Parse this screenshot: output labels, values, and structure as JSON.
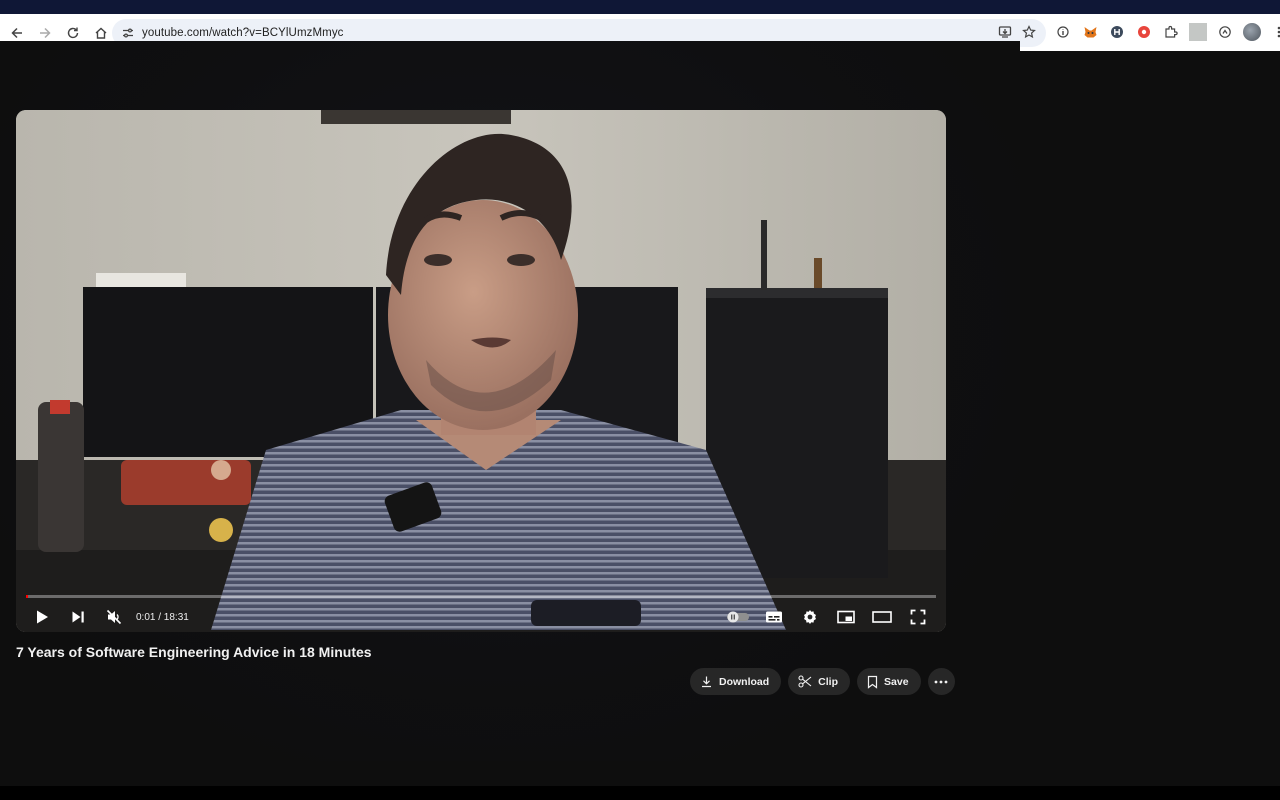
{
  "browser": {
    "url": "youtube.com/watch?v=BCYlUmzMmyc",
    "icons": [
      "back-icon",
      "forward-icon",
      "reload-icon",
      "home-icon",
      "site-info-icon",
      "install-icon",
      "bookmark-star-icon"
    ],
    "extensions": [
      "info-extension-icon",
      "metamask-fox-icon",
      "h-extension-icon",
      "record-extension-icon",
      "extensions-puzzle-icon",
      "sync-icon",
      "profile-avatar",
      "menu-kebab-icon"
    ]
  },
  "player": {
    "progress": 0.001,
    "time_display": "0:01 / 18:31",
    "controls_left": [
      "play-icon",
      "next-icon",
      "mute-icon"
    ],
    "controls_right": [
      "autoplay-toggle",
      "subtitles-icon",
      "settings-gear-icon",
      "miniplayer-icon",
      "theater-mode-icon",
      "fullscreen-icon"
    ],
    "colors": {
      "progress_fill": "#ff0000"
    }
  },
  "video": {
    "title": "7 Years of Software Engineering Advice in 18 Minutes"
  },
  "actions": {
    "download": "Download",
    "clip": "Clip",
    "save": "Save"
  }
}
